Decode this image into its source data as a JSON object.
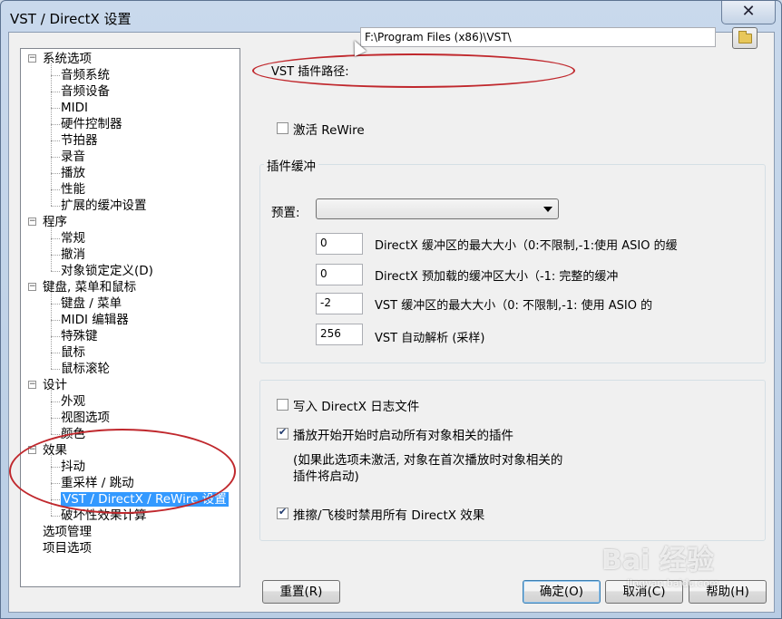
{
  "window": {
    "title": "VST / DirectX 设置",
    "close_glyph": "✕"
  },
  "tree": {
    "items": [
      {
        "label": "系统选项",
        "level": 0,
        "toggle": "−"
      },
      {
        "label": "音频系统",
        "level": 1
      },
      {
        "label": "音频设备",
        "level": 1
      },
      {
        "label": "MIDI",
        "level": 1
      },
      {
        "label": "硬件控制器",
        "level": 1
      },
      {
        "label": "节拍器",
        "level": 1
      },
      {
        "label": "录音",
        "level": 1
      },
      {
        "label": "播放",
        "level": 1
      },
      {
        "label": "性能",
        "level": 1
      },
      {
        "label": "扩展的缓冲设置",
        "level": 1
      },
      {
        "label": "程序",
        "level": 0,
        "toggle": "−"
      },
      {
        "label": "常规",
        "level": 1
      },
      {
        "label": "撤消",
        "level": 1
      },
      {
        "label": "对象锁定定义(D)",
        "level": 1
      },
      {
        "label": "键盘, 菜单和鼠标",
        "level": 0,
        "toggle": "−"
      },
      {
        "label": "键盘 / 菜单",
        "level": 1
      },
      {
        "label": "MIDI 编辑器",
        "level": 1
      },
      {
        "label": "特殊键",
        "level": 1
      },
      {
        "label": "鼠标",
        "level": 1
      },
      {
        "label": "鼠标滚轮",
        "level": 1
      },
      {
        "label": "设计",
        "level": 0,
        "toggle": "−"
      },
      {
        "label": "外观",
        "level": 1
      },
      {
        "label": "视图选项",
        "level": 1
      },
      {
        "label": "颜色",
        "level": 1
      },
      {
        "label": "效果",
        "level": 0,
        "toggle": "−"
      },
      {
        "label": "抖动",
        "level": 1
      },
      {
        "label": "重采样 / 跳动",
        "level": 1
      },
      {
        "label": "VST / DirectX / ReWire 设置",
        "level": 1,
        "selected": true
      },
      {
        "label": "破坏性效果计算",
        "level": 1
      },
      {
        "label": "选项管理",
        "level": 0
      },
      {
        "label": "项目选项",
        "level": 0
      }
    ]
  },
  "vst_path": {
    "label": "VST 插件路径:",
    "value": "F:\\Program Files (x86)\\VST\\"
  },
  "rewire": {
    "label": "激活 ReWire",
    "checked": false
  },
  "buffer_group": {
    "title": "插件缓冲",
    "preset_label": "预置:",
    "preset_value": "",
    "fields": [
      {
        "value": "0",
        "desc": "DirectX 缓冲区的最大大小（0:不限制,-1:使用 ASIO 的缓"
      },
      {
        "value": "0",
        "desc": "DirectX 预加载的缓冲区大小（-1: 完整的缓冲"
      },
      {
        "value": "-2",
        "desc": "VST 缓冲区的最大大小（0: 不限制,-1: 使用 ASIO 的"
      },
      {
        "value": "256",
        "desc": "VST 自动解析 (采样)"
      }
    ]
  },
  "options": {
    "log": {
      "label": "写入 DirectX 日志文件",
      "checked": false
    },
    "start_plugins": {
      "label": "播放开始开始时启动所有对象相关的插件",
      "checked": true
    },
    "note": "(如果此选项未激活, 对象在首次播放时对象相关的\n插件将启动)",
    "disable_scrub": {
      "label": "推擦/飞梭时禁用所有 DirectX 效果",
      "checked": true
    }
  },
  "buttons": {
    "reset": "重置(R)",
    "ok": "确定(O)",
    "cancel": "取消(C)",
    "help": "帮助(H)"
  },
  "watermark": {
    "main": "Bai 经验",
    "sub": "jingyan.baidu.com"
  },
  "colors": {
    "annotation": "#c0282d",
    "selection": "#3399ff"
  }
}
